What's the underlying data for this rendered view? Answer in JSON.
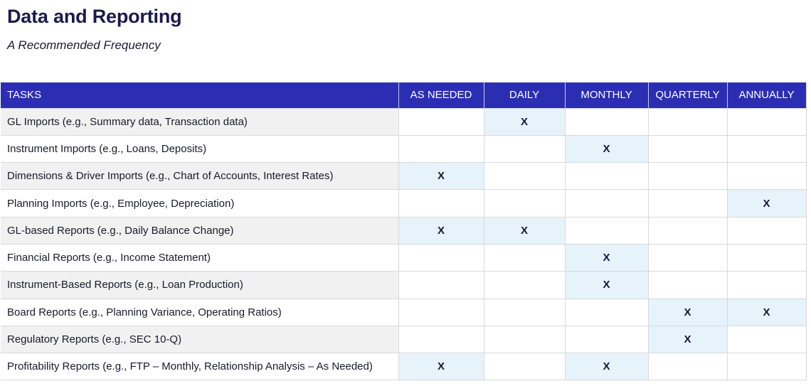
{
  "title": "Data and Reporting",
  "subtitle": "A Recommended Frequency",
  "table": {
    "columns": [
      "TASKS",
      "AS NEEDED",
      "DAILY",
      "MONTHLY",
      "QUARTERLY",
      "ANNUALLY"
    ],
    "mark_symbol": "X",
    "rows": [
      {
        "task": "GL Imports (e.g., Summary data, Transaction data)",
        "marks": [
          false,
          true,
          false,
          false,
          false
        ]
      },
      {
        "task": "Instrument Imports (e.g., Loans, Deposits)",
        "marks": [
          false,
          false,
          true,
          false,
          false
        ]
      },
      {
        "task": "Dimensions & Driver Imports (e.g., Chart of Accounts, Interest Rates)",
        "marks": [
          true,
          false,
          false,
          false,
          false
        ]
      },
      {
        "task": "Planning Imports (e.g., Employee, Depreciation)",
        "marks": [
          false,
          false,
          false,
          false,
          true
        ]
      },
      {
        "task": "GL-based Reports (e.g., Daily Balance Change)",
        "marks": [
          true,
          true,
          false,
          false,
          false
        ]
      },
      {
        "task": "Financial Reports (e.g., Income Statement)",
        "marks": [
          false,
          false,
          true,
          false,
          false
        ]
      },
      {
        "task": "Instrument-Based Reports (e.g., Loan Production)",
        "marks": [
          false,
          false,
          true,
          false,
          false
        ]
      },
      {
        "task": "Board Reports (e.g., Planning Variance, Operating Ratios)",
        "marks": [
          false,
          false,
          false,
          true,
          true
        ]
      },
      {
        "task": "Regulatory Reports (e.g., SEC 10-Q)",
        "marks": [
          false,
          false,
          false,
          true,
          false
        ]
      },
      {
        "task": "Profitability Reports (e.g., FTP – Monthly, Relationship Analysis – As Needed)",
        "marks": [
          true,
          false,
          true,
          false,
          false
        ]
      }
    ]
  }
}
